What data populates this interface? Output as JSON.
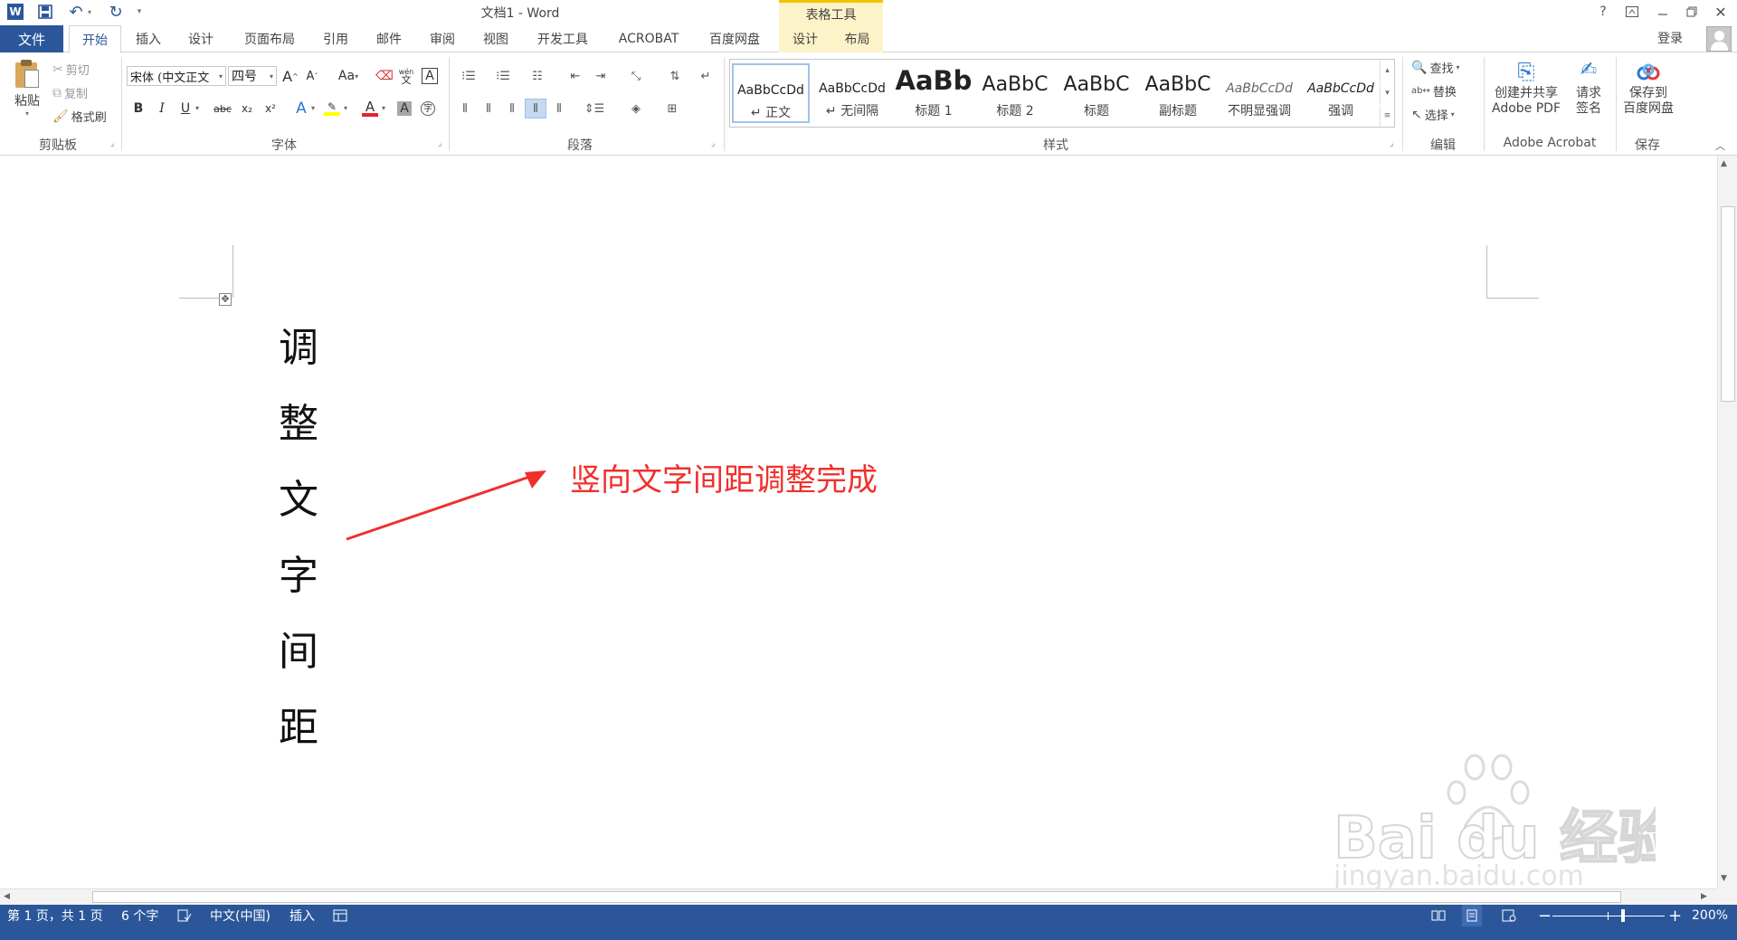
{
  "window": {
    "title": "文档1 - Word",
    "table_tools": "表格工具",
    "help": "?",
    "login": "登录"
  },
  "tabs": {
    "file": "文件",
    "home": "开始",
    "insert": "插入",
    "design": "设计",
    "layout": "页面布局",
    "references": "引用",
    "mailings": "邮件",
    "review": "审阅",
    "view": "视图",
    "developer": "开发工具",
    "acrobat": "ACROBAT",
    "baidu": "百度网盘",
    "tt_design": "设计",
    "tt_layout": "布局"
  },
  "clipboard": {
    "paste": "粘贴",
    "cut": "剪切",
    "copy": "复制",
    "format_painter": "格式刷",
    "label": "剪贴板"
  },
  "font": {
    "name": "宋体 (中文正文",
    "size": "四号",
    "label": "字体",
    "bold": "B",
    "italic": "I",
    "underline": "U",
    "strike": "abc",
    "sub": "x₂",
    "sup": "x²",
    "grow": "A",
    "shrink": "A",
    "case": "Aa",
    "color_letter": "A",
    "char_shading": "A",
    "char_border": "A",
    "text_effect": "A",
    "phonetic": "wén",
    "enclose": "字"
  },
  "paragraph": {
    "label": "段落"
  },
  "styles": {
    "label": "样式",
    "items": [
      {
        "preview": "AaBbCcDd",
        "name": "↵ 正文",
        "selected": true
      },
      {
        "preview": "AaBbCcDd",
        "name": "↵ 无间隔"
      },
      {
        "preview": "AaBb",
        "name": "标题 1"
      },
      {
        "preview": "AaBbC",
        "name": "标题 2"
      },
      {
        "preview": "AaBbC",
        "name": "标题"
      },
      {
        "preview": "AaBbC",
        "name": "副标题"
      },
      {
        "preview": "AaBbCcDd",
        "name": "不明显强调"
      },
      {
        "preview": "AaBbCcDd",
        "name": "强调"
      }
    ]
  },
  "editing": {
    "find": "查找",
    "replace": "替换",
    "select": "选择",
    "label": "编辑"
  },
  "acrobat": {
    "create_share_1": "创建并共享",
    "create_share_2": "Adobe PDF",
    "request_1": "请求",
    "request_2": "签名",
    "label": "Adobe Acrobat"
  },
  "save_group": {
    "save_1": "保存到",
    "save_2": "百度网盘",
    "label": "保存"
  },
  "document": {
    "chars": [
      "调",
      "整",
      "文",
      "字",
      "间",
      "距"
    ],
    "annotation": "竖向文字间距调整完成"
  },
  "status": {
    "page": "第 1 页，共 1 页",
    "words": "6 个字",
    "lang": "中文(中国)",
    "mode": "插入",
    "zoom": "200%",
    "zoom_percent": 200
  },
  "watermark": {
    "brand": "Bai du 经验",
    "url": "jingyan.baidu.com"
  }
}
